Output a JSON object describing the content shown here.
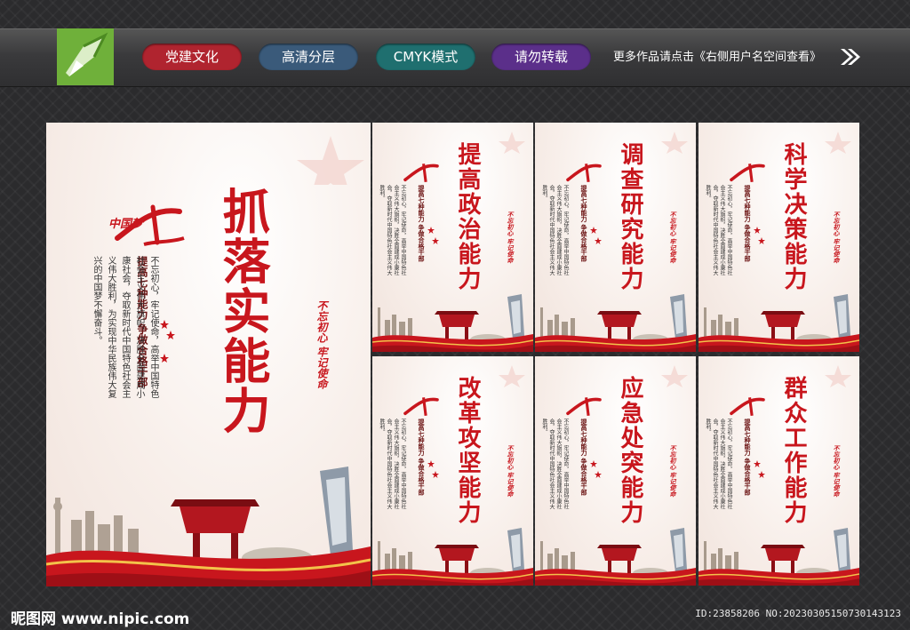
{
  "header": {
    "tags": [
      {
        "label": "党建文化",
        "color": "#b0242f"
      },
      {
        "label": "高清分层",
        "color": "#3a5a7a"
      },
      {
        "label": "CMYK模式",
        "color": "#1f6f6f"
      },
      {
        "label": "请勿转载",
        "color": "#5b2f8a"
      }
    ],
    "promo_text": "更多作品请点击《右侧用户名空间查看》",
    "icons": [
      "pen-logo-icon",
      "double-arrow-icon"
    ]
  },
  "main_board": {
    "title": "抓落实能力",
    "subtitle": "提高七种能力  争做合格干部",
    "body": "不忘初心，牢记使命，高举中国特色社会主义伟大旗帜，决胜全面建成小康社会，夺取新时代中国特色社会主义伟大胜利，为实现中华民族伟大复兴的中国梦不懈奋斗。",
    "seal": "不忘初心  牢记使命",
    "logo_text": "中国梦"
  },
  "small_boards": [
    {
      "title": "提高政治能力"
    },
    {
      "title": "调查研究能力"
    },
    {
      "title": "科学决策能力"
    },
    {
      "title": "改革攻坚能力"
    },
    {
      "title": "应急处突能力"
    },
    {
      "title": "群众工作能力"
    }
  ],
  "small_common": {
    "subtitle": "提高七种能力  争做合格干部",
    "seal": "不忘初心  牢记使命",
    "body": "不忘初心，牢记使命，高举中国特色社会主义伟大旗帜，决胜全面建成小康社会，夺取新时代中国特色社会主义伟大胜利。"
  },
  "footer": {
    "site": "昵图网 www.nipic.com",
    "id_text": "ID:23858206 NO:20230305150730143123"
  },
  "colors": {
    "accent_red": "#c8161d",
    "logo_green": "#6fb03a"
  }
}
